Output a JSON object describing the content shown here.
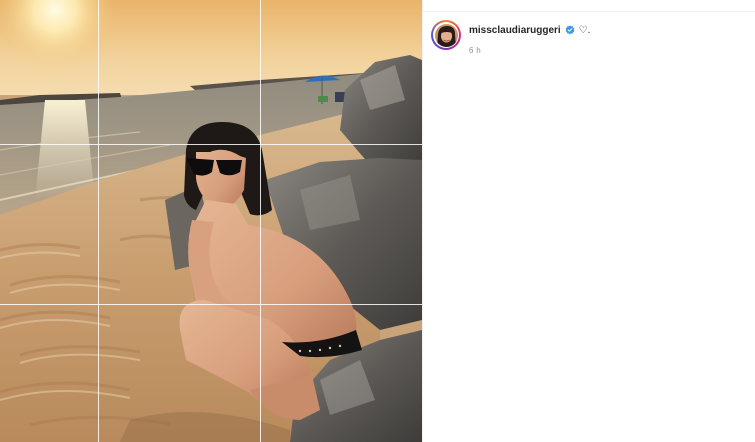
{
  "post": {
    "image_alt": "Woman in sunglasses crouching on a sandy beach by rocks at sunset",
    "crop_grid": "3x3"
  },
  "author": {
    "username": "missclaudiaruggeri",
    "verified": true
  },
  "caption": {
    "text": "♡."
  },
  "meta": {
    "time_ago": "6 h"
  },
  "colors": {
    "verified_blue": "#3897f0",
    "text_primary": "#262626",
    "text_secondary": "#8e8e8e"
  },
  "icons": {
    "verified": "verified-badge-icon",
    "avatar": "avatar-icon"
  }
}
